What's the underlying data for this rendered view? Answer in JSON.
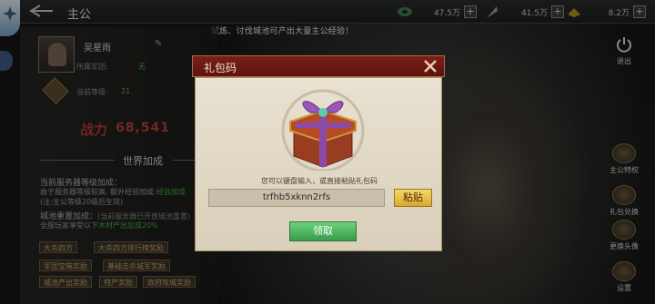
{
  "header": {
    "title": "主公",
    "resources": [
      {
        "value": "47.5万",
        "icon": "jade-icon"
      },
      {
        "value": "41.5万",
        "icon": "feather-icon"
      },
      {
        "value": "8.2万",
        "icon": "gold-icon"
      }
    ],
    "plus": "+"
  },
  "notice": "试炼、讨伐城池可产出大量主公经验！",
  "profile": {
    "name": "吴星雨",
    "legion_label": "所属军团:",
    "legion_value": "无",
    "level_label": "当前等级:",
    "level_value": "21",
    "power_label": "战力",
    "power_value": "68,541"
  },
  "world_bonus": {
    "title": "世界加成",
    "server_heading": "当前服务器等级加成：",
    "server_line1_a": "由于服务器等级较高, 额外经验加成:",
    "server_line1_b": "经验",
    "server_line1_c": "加成",
    "server_line2": "(注:主公等级20级后生效)",
    "city_heading": "城池重置加成：",
    "city_heading_note": "(当前服务器已开放城池重置)",
    "city_line_a": "全服玩家享受以下",
    "city_line_b": "木材产出",
    "city_line_c": "加成",
    "city_line_d": "20%"
  },
  "tags": [
    "大杀四方",
    "大杀四方排行榜奖励",
    "军团宝箱奖励",
    "基础击杀城军奖励",
    "城池产出奖励",
    "特产奖励",
    "政府攻城奖励"
  ],
  "sidebar": [
    {
      "label": "退出"
    },
    {
      "label": "主公特权"
    },
    {
      "label": "礼包兑换"
    },
    {
      "label": "更换头像"
    },
    {
      "label": "设置"
    }
  ],
  "modal": {
    "title": "礼包码",
    "hint": "您可以键盘输入，或直接粘贴礼包码",
    "code_value": "trfhb5xknn2rfs",
    "paste_label": "粘贴",
    "claim_label": "领取"
  },
  "colors": {
    "modal_header": "#7a1f18",
    "claim_button": "#3a9a4c",
    "paste_button": "#f0c850",
    "power": "#b8403a",
    "highlight_green": "#46b046"
  }
}
